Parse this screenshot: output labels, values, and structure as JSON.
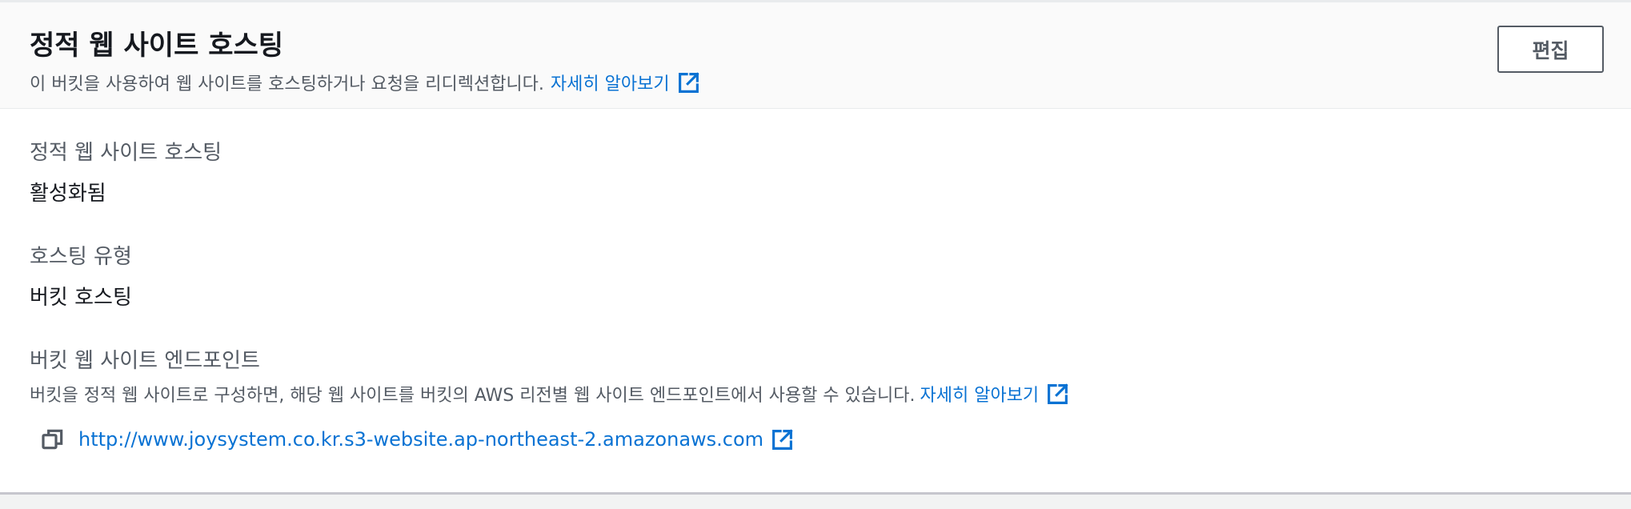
{
  "header": {
    "title": "정적 웹 사이트 호스팅",
    "description": "이 버킷을 사용하여 웹 사이트를 호스팅하거나 요청을 리디렉션합니다.",
    "learn_more": "자세히 알아보기",
    "edit_label": "편집"
  },
  "fields": {
    "hosting": {
      "label": "정적 웹 사이트 호스팅",
      "value": "활성화됨"
    },
    "hosting_type": {
      "label": "호스팅 유형",
      "value": "버킷 호스팅"
    },
    "endpoint": {
      "label": "버킷 웹 사이트 엔드포인트",
      "description": "버킷을 정적 웹 사이트로 구성하면, 해당 웹 사이트를 버킷의 AWS 리전별 웹 사이트 엔드포인트에서 사용할 수 있습니다.",
      "learn_more": "자세히 알아보기",
      "url": "http://www.joysystem.co.kr.s3-website.ap-northeast-2.amazonaws.com"
    }
  },
  "icons": {
    "external": "external-link-icon",
    "copy": "copy-icon"
  },
  "colors": {
    "link": "#0972d3",
    "text": "#16191f",
    "secondary_text": "#545b64"
  }
}
